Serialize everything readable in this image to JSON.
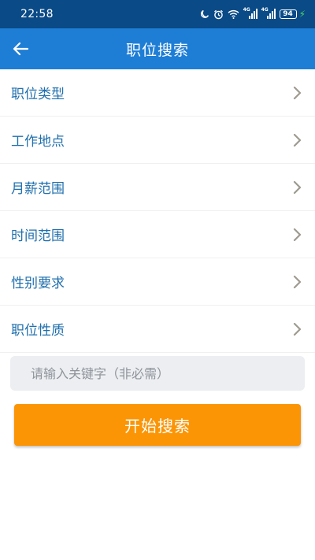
{
  "status_bar": {
    "time": "22:58",
    "network_1": "4G",
    "network_2": "4G",
    "battery_level": "94",
    "icons": [
      "moon-icon",
      "alarm-icon",
      "wifi-icon",
      "signal-icon",
      "signal-icon",
      "battery-icon",
      "charging-icon"
    ]
  },
  "header": {
    "title": "职位搜索",
    "back_icon": "arrow-left-icon"
  },
  "filters": [
    {
      "label": "职位类型"
    },
    {
      "label": "工作地点"
    },
    {
      "label": "月薪范围"
    },
    {
      "label": "时间范围"
    },
    {
      "label": "性别要求"
    },
    {
      "label": "职位性质"
    }
  ],
  "search": {
    "value": "",
    "placeholder": "请输入关键字（非必需）"
  },
  "action": {
    "label": "开始搜索"
  },
  "colors": {
    "status_bar": "#0a4a86",
    "app_bar": "#1e7ed6",
    "filter_text": "#1f6fad",
    "chevron": "#9e9a8f",
    "button": "#fb9505",
    "input_bg": "#eceef1"
  }
}
